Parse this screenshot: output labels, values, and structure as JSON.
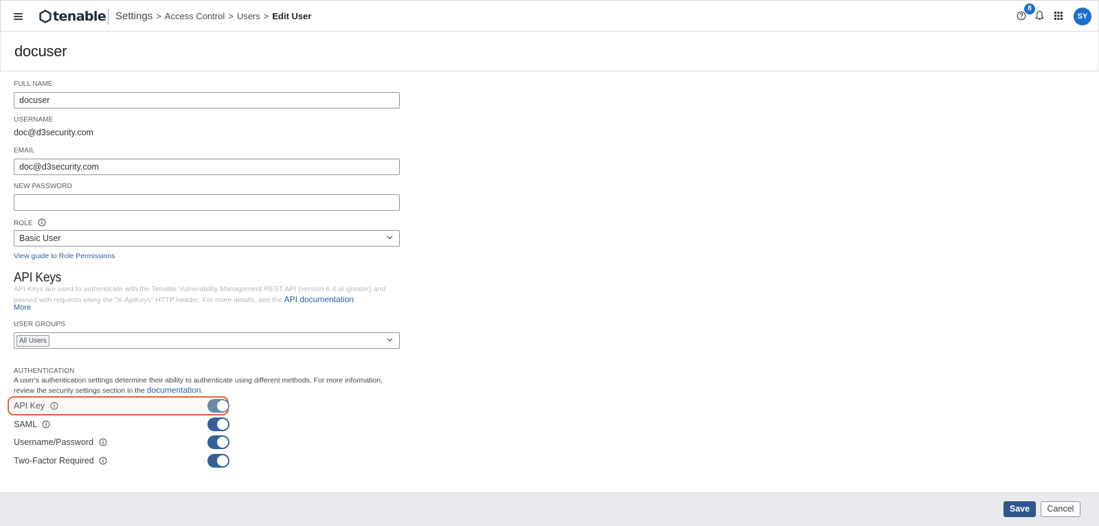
{
  "brand": {
    "name": "tenable",
    "accent": "#1a6ecf"
  },
  "breadcrumb": {
    "root": "Settings",
    "items": [
      "Access Control",
      "Users"
    ],
    "current": "Edit User",
    "separator": ">"
  },
  "topbar": {
    "notification_count": "8",
    "avatar_initials": "SY",
    "icons": [
      "menu-icon",
      "help-icon",
      "bell-icon",
      "app-grid-icon"
    ]
  },
  "page": {
    "title": "docuser"
  },
  "form": {
    "full_name": {
      "label": "FULL NAME",
      "value": "docuser"
    },
    "username": {
      "label": "USERNAME",
      "value": "doc@d3security.com"
    },
    "email": {
      "label": "EMAIL",
      "value": "doc@d3security.com"
    },
    "new_password": {
      "label": "NEW PASSWORD",
      "value": ""
    },
    "role": {
      "label": "ROLE",
      "value": "Basic User"
    },
    "role_guide_link": "View guide to Role Permissions"
  },
  "api_keys": {
    "title": "API Keys",
    "description": "API Keys are used to authenticate with the Tenable Vulnerability Management REST API (version 6.4 or greater) and passed with requests using the \"X-ApiKeys\" HTTP header. For more details, see the",
    "doc_link": "API documentation",
    "more_link": "More"
  },
  "user_groups": {
    "label": "USER GROUPS",
    "selected_tag": "All Users"
  },
  "authentication": {
    "label": "AUTHENTICATION",
    "description": "A user's authentication settings determine their ability to authenticate using different methods. For more information, review the security settings section in the",
    "doc_link": "documentation",
    "options": [
      {
        "label": "API Key",
        "enabled": true
      },
      {
        "label": "SAML",
        "enabled": true
      },
      {
        "label": "Username/Password",
        "enabled": true
      },
      {
        "label": "Two-Factor Required",
        "enabled": true
      }
    ]
  },
  "footer": {
    "save_label": "Save",
    "cancel_label": "Cancel"
  },
  "colors": {
    "toggle_on": "#34609a",
    "highlight": "#e0633a",
    "save_button": "#30578c"
  }
}
